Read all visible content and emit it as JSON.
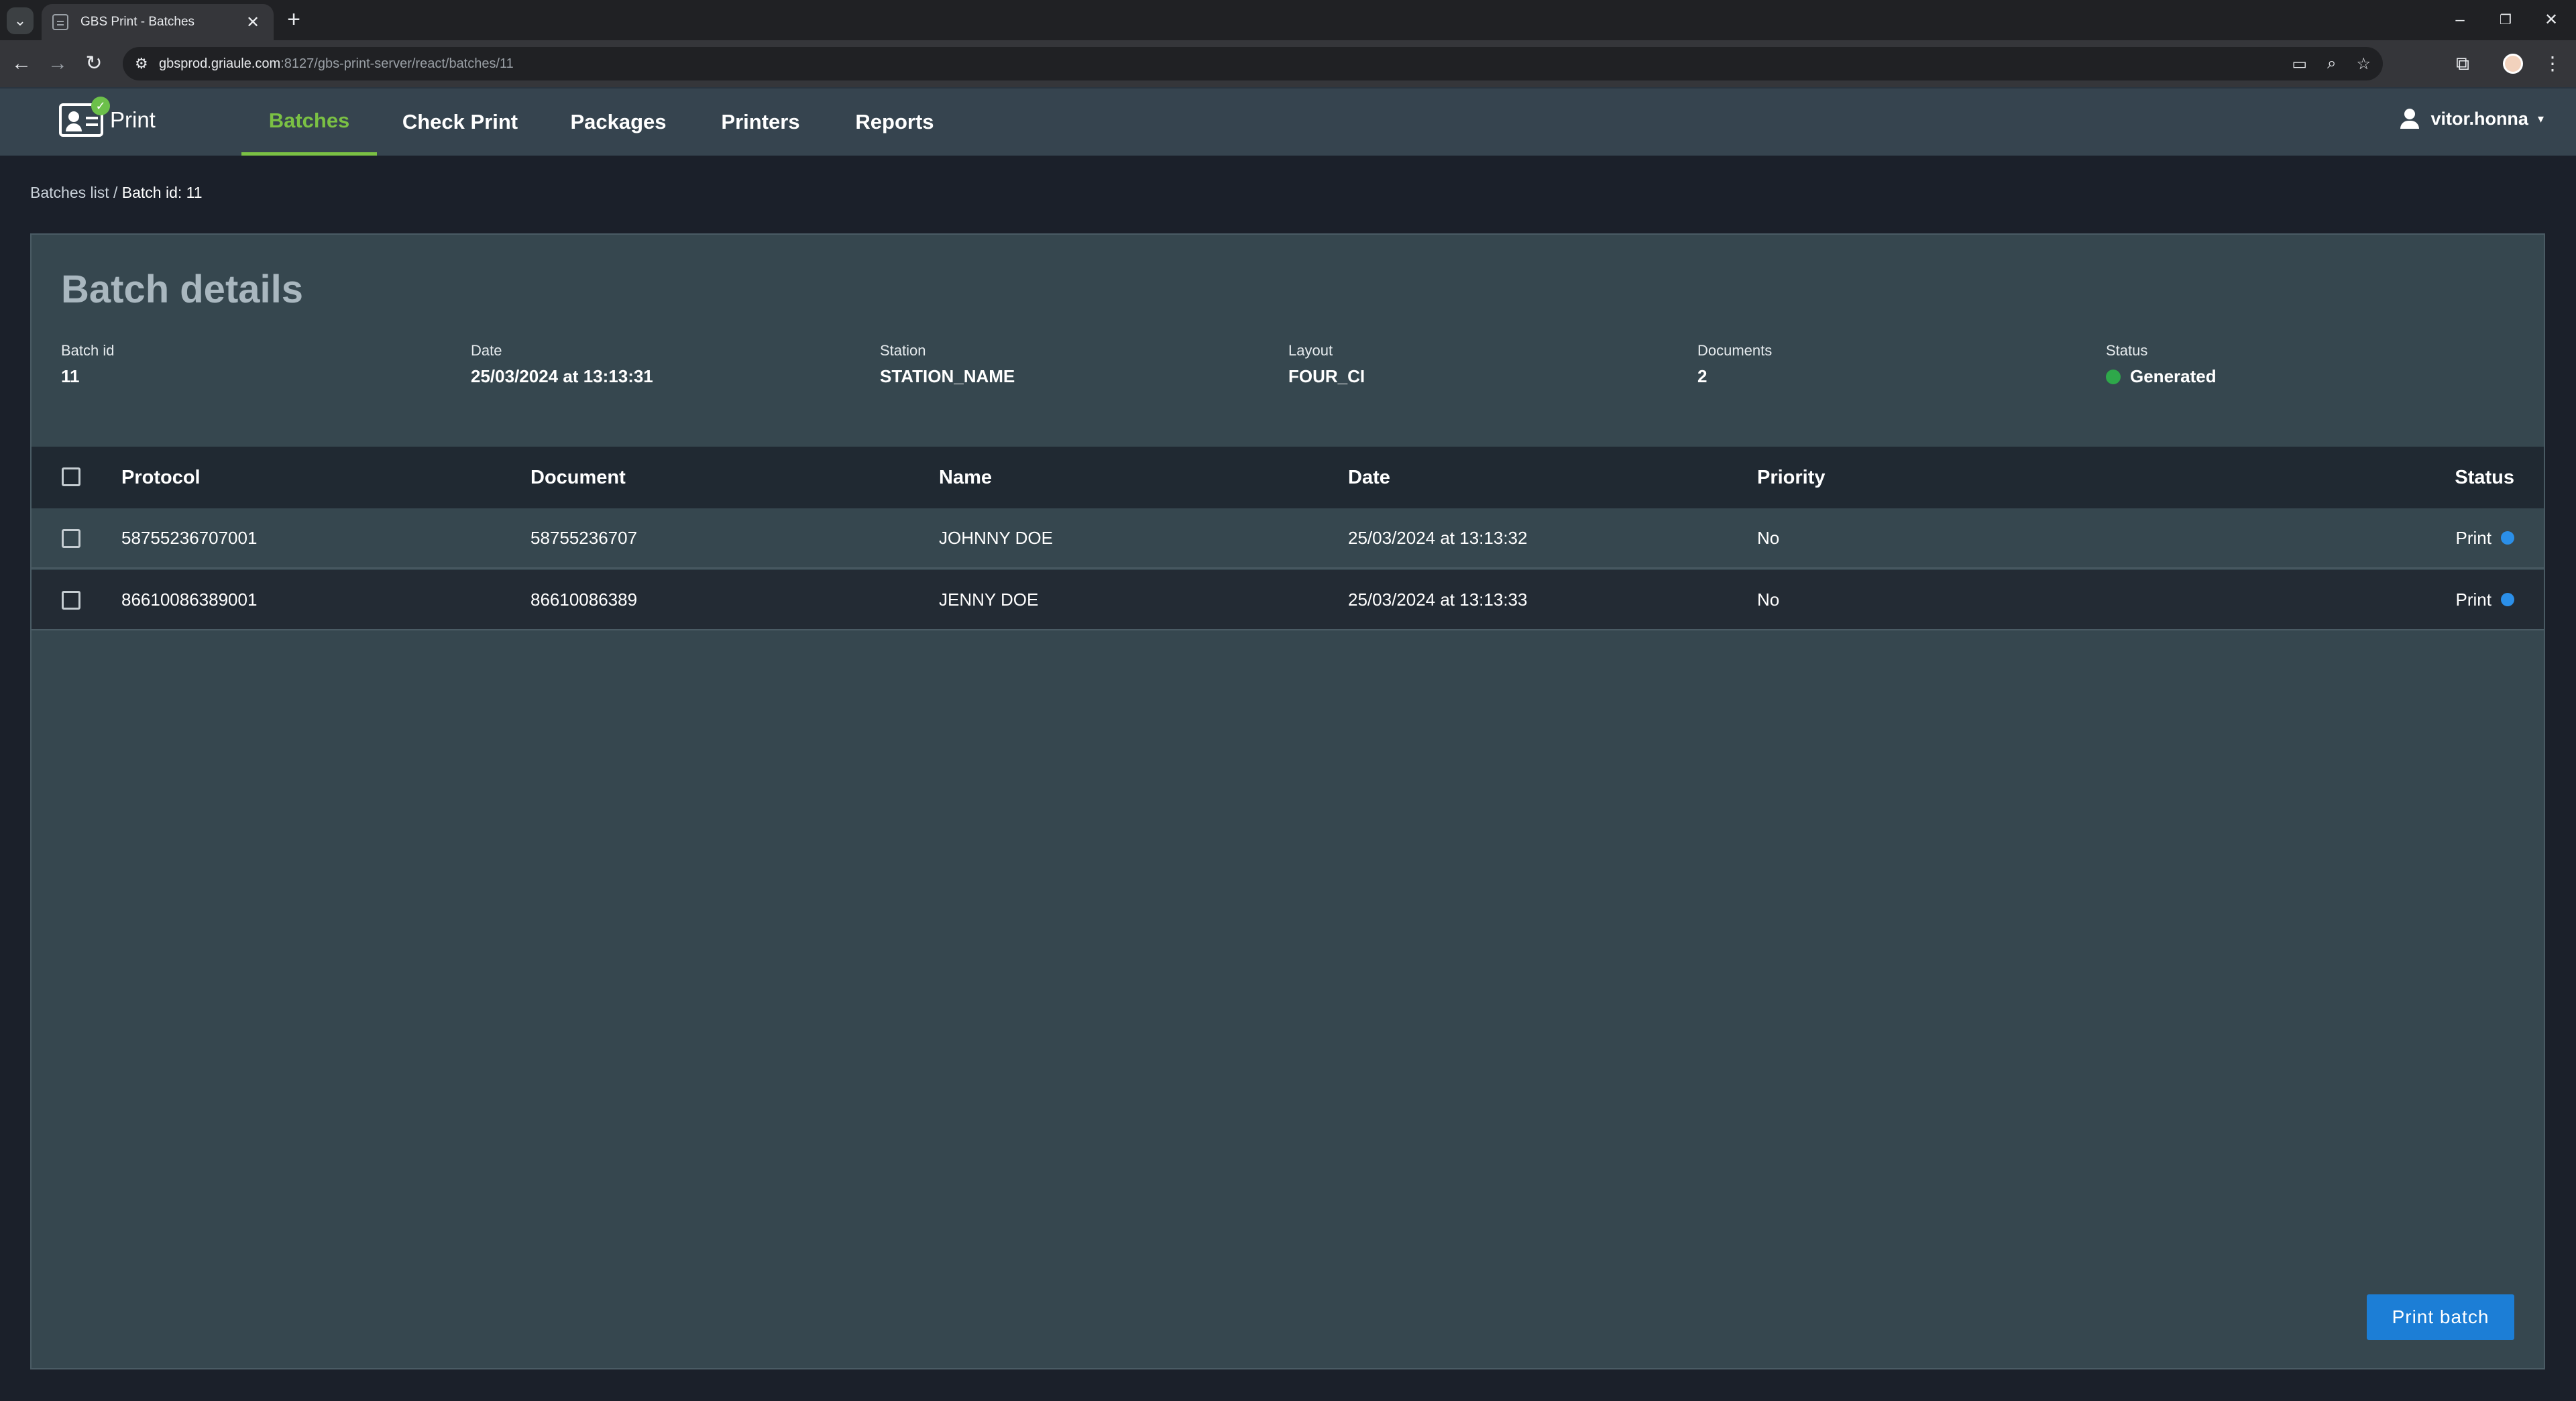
{
  "browser": {
    "tab_title": "GBS Print - Batches",
    "tab_close": "✕",
    "new_tab": "+",
    "url_host": "gbsprod.griaule.com",
    "url_rest": ":8127/gbs-print-server/react/batches/11",
    "window_controls": {
      "minimize": "–",
      "restore": "❐",
      "close": "✕"
    }
  },
  "header": {
    "logo_text": "Print",
    "nav": [
      {
        "label": "Batches",
        "active": true
      },
      {
        "label": "Check Print",
        "active": false
      },
      {
        "label": "Packages",
        "active": false
      },
      {
        "label": "Printers",
        "active": false
      },
      {
        "label": "Reports",
        "active": false
      }
    ],
    "user": {
      "name": "vitor.honna",
      "caret": "▾"
    }
  },
  "breadcrumb": {
    "parent": "Batches list",
    "separator": " / ",
    "current": "Batch id: 11"
  },
  "batch": {
    "title": "Batch details",
    "fields": [
      {
        "label": "Batch id",
        "value": "11"
      },
      {
        "label": "Date",
        "value": "25/03/2024 at 13:13:31"
      },
      {
        "label": "Station",
        "value": "STATION_NAME"
      },
      {
        "label": "Layout",
        "value": "FOUR_CI"
      },
      {
        "label": "Documents",
        "value": "2"
      },
      {
        "label": "Status",
        "value": "Generated",
        "status_color": "#2ea84a"
      }
    ]
  },
  "table": {
    "columns": [
      "Protocol",
      "Document",
      "Name",
      "Date",
      "Priority",
      "Status"
    ],
    "rows": [
      {
        "protocol": "58755236707001",
        "document": "58755236707",
        "name": "JOHNNY DOE",
        "date": "25/03/2024 at 13:13:32",
        "priority": "No",
        "status": "Print",
        "status_color": "#2b8fe8"
      },
      {
        "protocol": "86610086389001",
        "document": "86610086389",
        "name": "JENNY DOE",
        "date": "25/03/2024 at 13:13:33",
        "priority": "No",
        "status": "Print",
        "status_color": "#2b8fe8"
      }
    ]
  },
  "actions": {
    "print_batch": "Print batch"
  },
  "theme": {
    "accent": "#7bc144",
    "primary_button": "#1c7ed6"
  }
}
